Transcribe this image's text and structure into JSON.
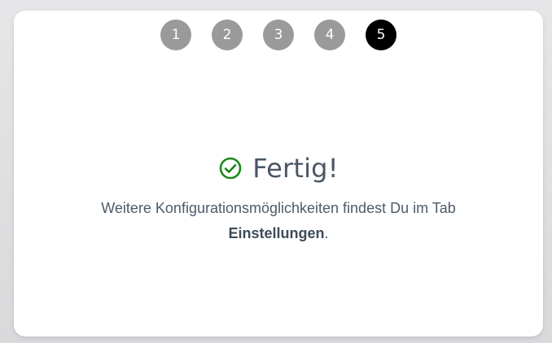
{
  "stepper": {
    "steps": [
      "1",
      "2",
      "3",
      "4",
      "5"
    ],
    "active_step": "5"
  },
  "result": {
    "title": "Fertig!",
    "description_prefix": "Weitere Konfigurationsmöglichkeiten findest Du im Tab",
    "description_link": "Einstellungen",
    "description_suffix": "."
  },
  "colors": {
    "step_done": "#9a9a9a",
    "step_active": "#000000",
    "success_icon": "#1a8a1a",
    "text": "#4d5b69"
  },
  "icons": {
    "success": "check-circle-icon"
  }
}
